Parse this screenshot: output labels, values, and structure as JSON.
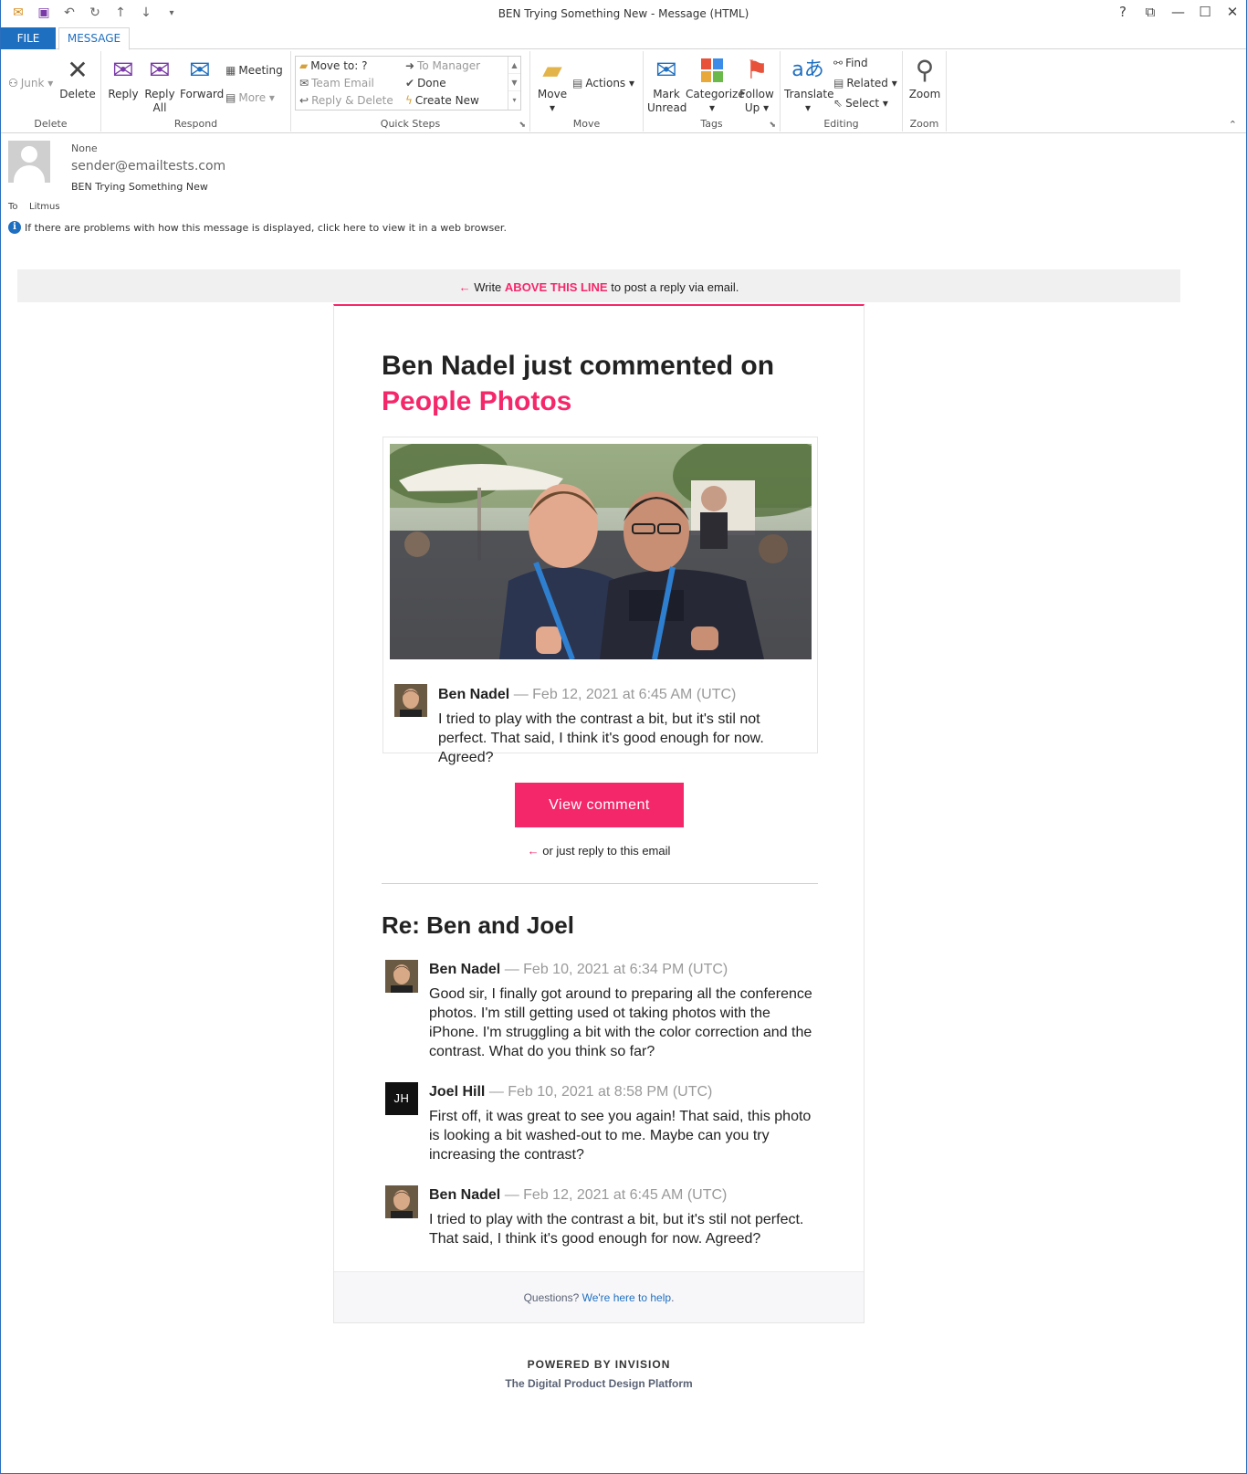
{
  "window": {
    "title": "BEN Trying Something New - Message (HTML)",
    "controls": [
      "?",
      "⧉",
      "—",
      "☐",
      "✕"
    ]
  },
  "tabs": {
    "file": "FILE",
    "message": "MESSAGE"
  },
  "ribbon": {
    "delete_group": {
      "label": "Delete",
      "junk": "Junk",
      "delete": "Delete"
    },
    "respond_group": {
      "label": "Respond",
      "reply": "Reply",
      "reply_all_1": "Reply",
      "reply_all_2": "All",
      "forward": "Forward",
      "meeting": "Meeting",
      "more": "More"
    },
    "quick_steps": {
      "label": "Quick Steps",
      "move_to": "Move to: ?",
      "team_email": "Team Email",
      "reply_delete": "Reply & Delete",
      "to_manager": "To Manager",
      "done": "Done",
      "create_new": "Create New"
    },
    "move_group": {
      "label": "Move",
      "move": "Move",
      "actions": "Actions"
    },
    "tags_group": {
      "label": "Tags",
      "mark_unread_1": "Mark",
      "mark_unread_2": "Unread",
      "categorize": "Categorize",
      "follow_up_1": "Follow",
      "follow_up_2": "Up"
    },
    "editing_group": {
      "label": "Editing",
      "translate": "Translate",
      "find": "Find",
      "related": "Related",
      "select": "Select"
    },
    "zoom_group": {
      "label": "Zoom",
      "zoom": "Zoom"
    }
  },
  "header": {
    "none": "None",
    "from": "sender@emailtests.com",
    "subject": "BEN Trying Something New",
    "to_label": "To",
    "to": "Litmus",
    "info": "If there are problems with how this message is displayed, click here to view it in a web browser."
  },
  "email": {
    "reply_strip": {
      "arrow": "←",
      "write": "Write",
      "above": "ABOVE THIS LINE",
      "rest": "to post a reply via email."
    },
    "headline": {
      "main": "Ben Nadel just commented on",
      "target": "People Photos"
    },
    "featured_comment": {
      "author": "Ben Nadel",
      "meta": "— Feb 12, 2021 at 6:45 AM (UTC)",
      "text": "I tried to play with the contrast a bit, but it's stil not perfect. That said, I think it's good enough for now. Agreed?"
    },
    "view_button": "View comment",
    "or_reply": {
      "arrow": "←",
      "text": "or just reply to this email"
    },
    "thread_title": "Re: Ben and Joel",
    "thread": [
      {
        "author": "Ben Nadel",
        "meta": "— Feb 10, 2021 at 6:34 PM (UTC)",
        "text": "Good sir, I finally got around to preparing all the conference photos. I'm still getting used ot taking photos with the iPhone. I'm struggling a bit with the color correction and the contrast. What do you think so far?"
      },
      {
        "author": "Joel Hill",
        "initials": "JH",
        "meta": "— Feb 10, 2021 at 8:58 PM (UTC)",
        "text": "First off, it was great to see you again! That said, this photo is looking a bit washed-out to me. Maybe can you try increasing the contrast?"
      },
      {
        "author": "Ben Nadel",
        "meta": "— Feb 12, 2021 at 6:45 AM (UTC)",
        "text": "I tried to play with the contrast a bit, but it's stil not perfect. That said, I think it's good enough for now. Agreed?"
      }
    ],
    "footer": {
      "questions": "Questions?",
      "help": "We're here to help",
      "period": "."
    },
    "powered": "POWERED BY INVISION",
    "platform": "The Digital Product Design Platform"
  },
  "colors": {
    "brand_pink": "#f5276b",
    "office_blue": "#1f6fc1"
  }
}
